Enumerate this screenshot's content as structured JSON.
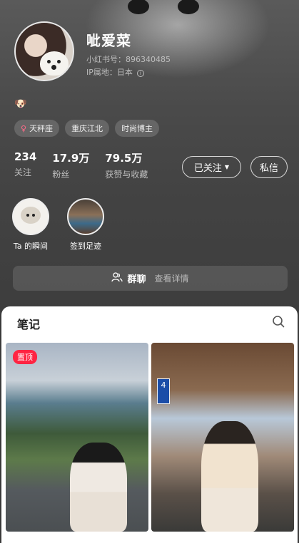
{
  "profile": {
    "username": "呲爱菜",
    "redbook_id": "小红书号：896340485",
    "ip_location": "IP属地：日本",
    "emoji": "🐶"
  },
  "tags": [
    {
      "label": "天秤座",
      "icon": "female-icon"
    },
    {
      "label": "重庆江北"
    },
    {
      "label": "时尚博主"
    }
  ],
  "stats": [
    {
      "value": "234",
      "label": "关注"
    },
    {
      "value": "17.9万",
      "label": "粉丝"
    },
    {
      "value": "79.5万",
      "label": "获赞与收藏"
    }
  ],
  "actions": {
    "follow_label": "已关注",
    "message_label": "私信"
  },
  "bubbles": [
    {
      "label": "Ta 的瞬间"
    },
    {
      "label": "签到足迹"
    }
  ],
  "group": {
    "title": "群聊",
    "subtitle": "查看详情"
  },
  "notes": {
    "title": "笔记",
    "pinned_badge": "置顶",
    "sign_text": "4"
  },
  "colors": {
    "accent": "#ff2442",
    "panel_bg": "#ffffff",
    "header_bg": "#474747"
  }
}
